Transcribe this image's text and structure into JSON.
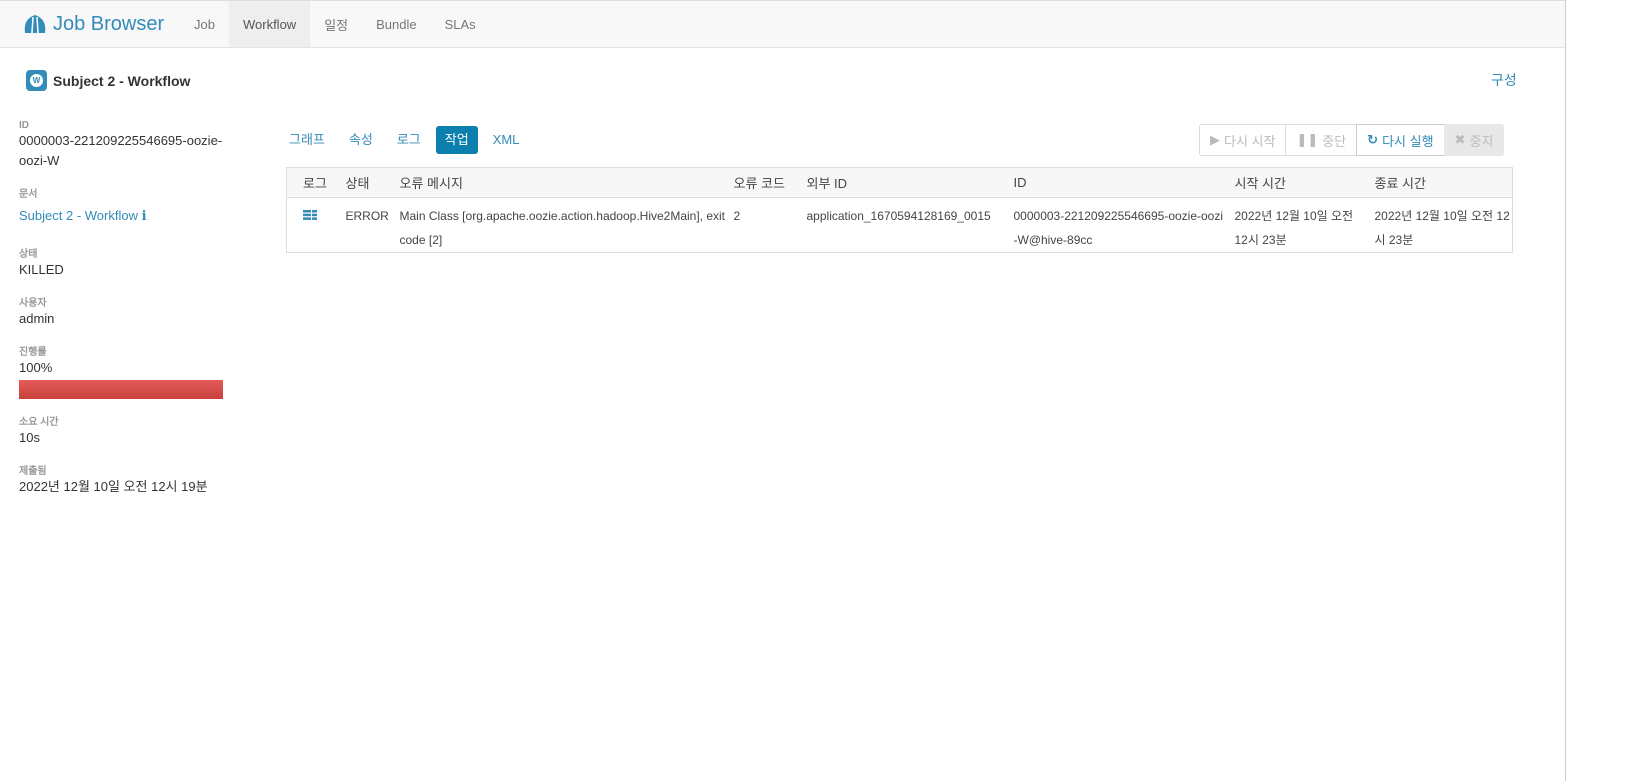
{
  "nav": {
    "brand": "Job Browser",
    "items": [
      {
        "label": "Job"
      },
      {
        "label": "Workflow",
        "active": true
      },
      {
        "label": "일정"
      },
      {
        "label": "Bundle"
      },
      {
        "label": "SLAs"
      }
    ]
  },
  "header": {
    "title": "Subject 2 - Workflow",
    "badge": "W",
    "config": "구성"
  },
  "side": {
    "id_label": "ID",
    "id": "0000003-221209225546695-oozie-oozi-W",
    "doc_label": "문서",
    "doc": "Subject 2 - Workflow",
    "status_label": "상태",
    "status": "KILLED",
    "user_label": "사용자",
    "user": "admin",
    "progress_label": "진행률",
    "progress": "100%",
    "progress_value": 100,
    "duration_label": "소요 시간",
    "duration": "10s",
    "submitted_label": "제출됨",
    "submitted": "2022년 12월 10일 오전 12시 19분"
  },
  "tabs": [
    {
      "label": "그래프"
    },
    {
      "label": "속성"
    },
    {
      "label": "로그"
    },
    {
      "label": "작업",
      "active": true
    },
    {
      "label": "XML"
    }
  ],
  "buttons": {
    "resume": "다시 시작",
    "suspend": "중단",
    "rerun": "다시 실행",
    "kill": "중지"
  },
  "table": {
    "headers": [
      "로그",
      "상태",
      "오류 메시지",
      "오류 코드",
      "외부 ID",
      "ID",
      "시작 시간",
      "종료 시간"
    ],
    "rows": [
      {
        "status": "ERROR",
        "error_message": "Main Class [org.apache.oozie.action.hadoop.Hive2Main], exit code [2]",
        "error_code": "2",
        "external_id": "application_1670594128169_0015",
        "id": "0000003-221209225546695-oozie-oozi-W@hive-89cc",
        "start": "2022년 12월 10일 오전 12시 23분",
        "end": "2022년 12월 10일 오전 12시 23분"
      }
    ]
  },
  "colors": {
    "accent": "#338bb8",
    "active_tab": "#0b7fad",
    "progress": "#d9534f"
  }
}
